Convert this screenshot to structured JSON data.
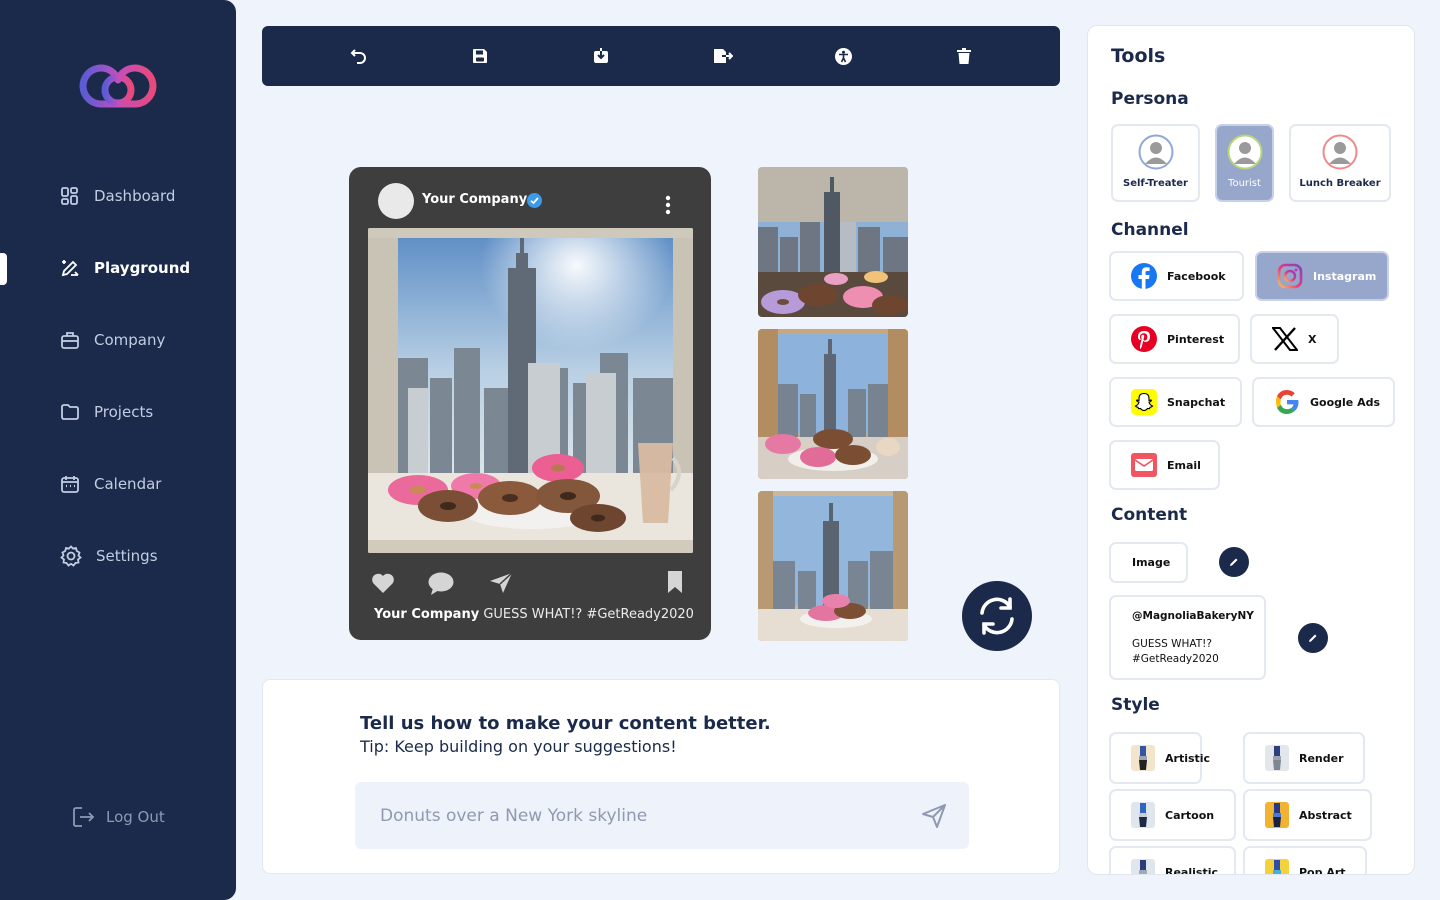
{
  "sidebar": {
    "items": [
      {
        "label": "Dashboard",
        "icon": "dashboard-icon"
      },
      {
        "label": "Playground",
        "icon": "pen-ruler-icon",
        "active": true
      },
      {
        "label": "Company",
        "icon": "briefcase-icon"
      },
      {
        "label": "Projects",
        "icon": "folder-icon"
      },
      {
        "label": "Calendar",
        "icon": "calendar-icon"
      },
      {
        "label": "Settings",
        "icon": "gear-icon"
      }
    ],
    "logout_label": "Log Out"
  },
  "toolbar": {
    "buttons": [
      "undo-icon",
      "save-icon",
      "download-icon",
      "export-icon",
      "accessibility-icon",
      "trash-icon"
    ]
  },
  "post": {
    "company_name": "Your Company",
    "caption_author": "Your Company",
    "caption_text": "GUESS WHAT!? #GetReady2020"
  },
  "feedback": {
    "title": "Tell us how to make your content better.",
    "tip": "Tip: Keep building on your suggestions!",
    "placeholder": "Donuts over a New York skyline"
  },
  "tools": {
    "title": "Tools",
    "persona_heading": "Persona",
    "personas": [
      {
        "label": "Self-Treater",
        "ring": "#8fa8d8"
      },
      {
        "label": "Tourist",
        "ring": "#b7d57a",
        "selected": true
      },
      {
        "label": "Lunch Breaker",
        "ring": "#f08a8a"
      }
    ],
    "channel_heading": "Channel",
    "channels": [
      {
        "label": "Facebook",
        "icon": "facebook-icon"
      },
      {
        "label": "Instagram",
        "icon": "instagram-icon",
        "selected": true
      },
      {
        "label": "Pinterest",
        "icon": "pinterest-icon"
      },
      {
        "label": "X",
        "icon": "x-icon"
      },
      {
        "label": "Snapchat",
        "icon": "snapchat-icon"
      },
      {
        "label": "Google Ads",
        "icon": "google-icon"
      },
      {
        "label": "Email",
        "icon": "email-icon"
      }
    ],
    "content_heading": "Content",
    "content_image_label": "Image",
    "content_text_handle": "@MagnoliaBakeryNY",
    "content_text_line1": "GUESS WHAT!?",
    "content_text_line2": "#GetReady2020",
    "style_heading": "Style",
    "styles": [
      "Artistic",
      "Render",
      "Cartoon",
      "Abstract",
      "Realistic",
      "Pop Art"
    ]
  },
  "colors": {
    "navy": "#1b2a4a",
    "selected": "#97a6cb",
    "background": "#eff3fb"
  }
}
